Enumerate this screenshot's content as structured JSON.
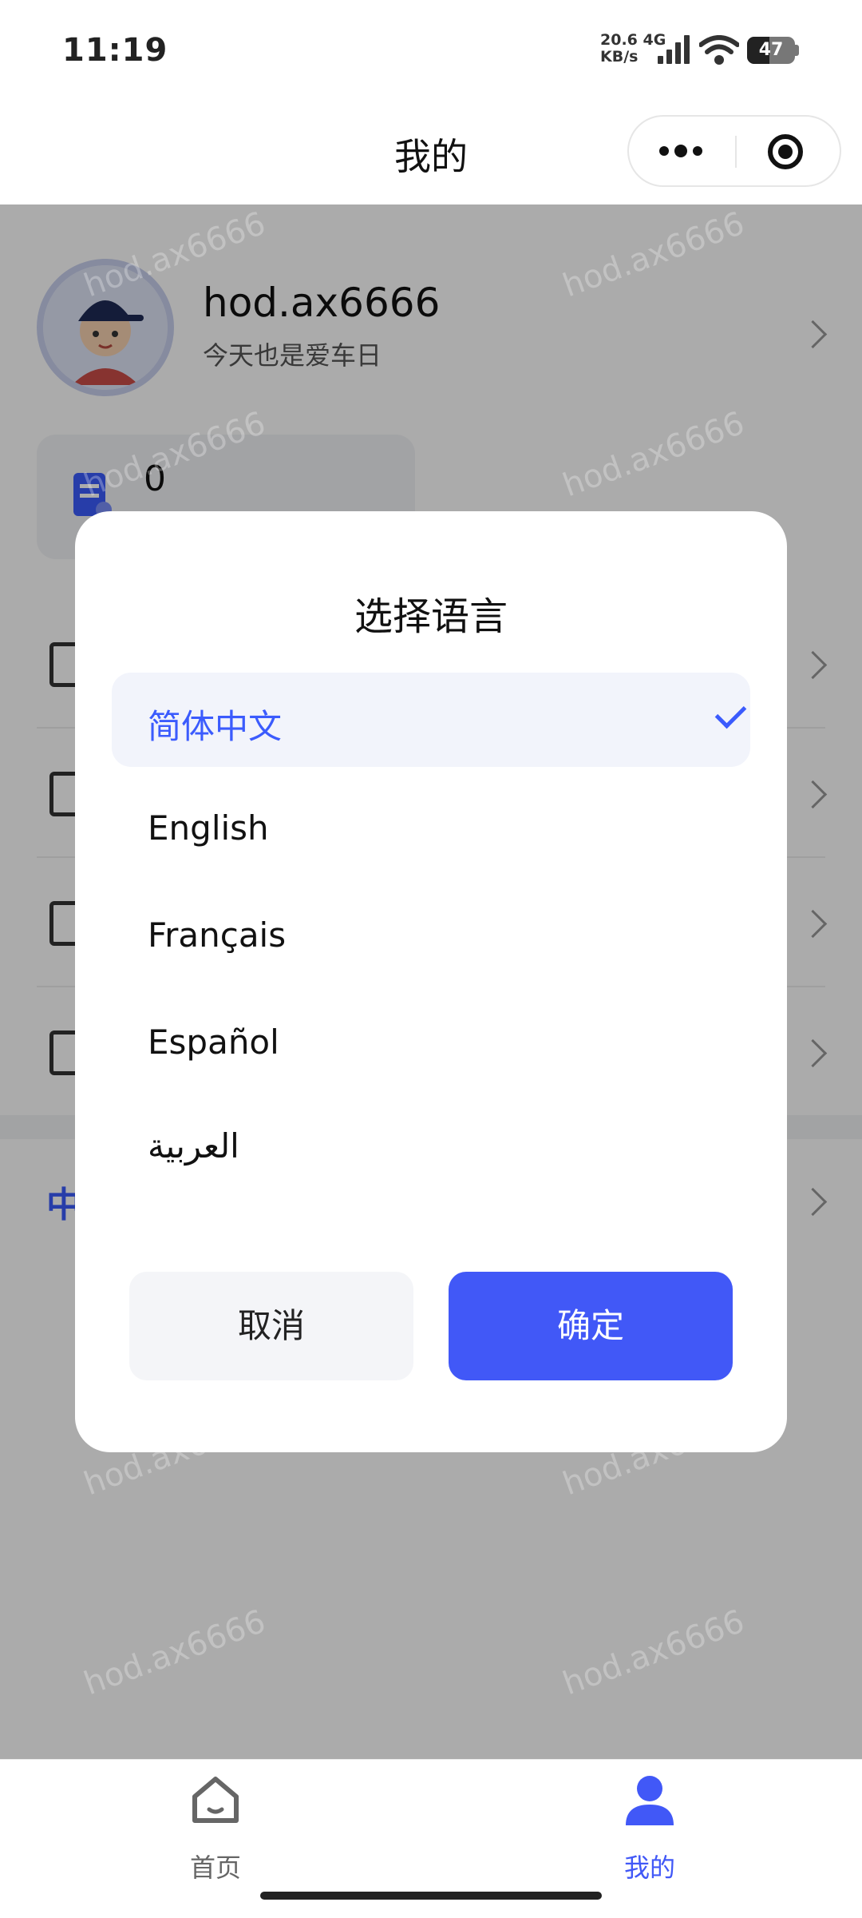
{
  "status_bar": {
    "time": "11:19",
    "net_speed_value": "20.6",
    "net_speed_unit": "KB/s",
    "network": "4G",
    "battery": "47",
    "battery_level": 0.47
  },
  "nav": {
    "title": "我的",
    "more_icon": "more-dots-icon",
    "target_icon": "target-icon"
  },
  "profile": {
    "username": "hod.ax6666",
    "subtitle": "今天也是爱车日"
  },
  "stats": {
    "value": "0"
  },
  "watermark_text": "hod.ax6666",
  "modal": {
    "title": "选择语言",
    "options": [
      {
        "label": "简体中文",
        "selected": true
      },
      {
        "label": "English",
        "selected": false
      },
      {
        "label": "Français",
        "selected": false
      },
      {
        "label": "Español",
        "selected": false
      },
      {
        "label": "العربية",
        "selected": false
      }
    ],
    "cancel_label": "取消",
    "confirm_label": "确定"
  },
  "tabs": [
    {
      "label": "首页",
      "icon": "home-icon",
      "active": false
    },
    {
      "label": "我的",
      "icon": "user-icon",
      "active": true
    }
  ],
  "lang_row_glyph": "中",
  "colors": {
    "accent": "#4158f7",
    "selected_text": "#3b5bfd",
    "overlay": "rgba(0,0,0,0.33)"
  }
}
